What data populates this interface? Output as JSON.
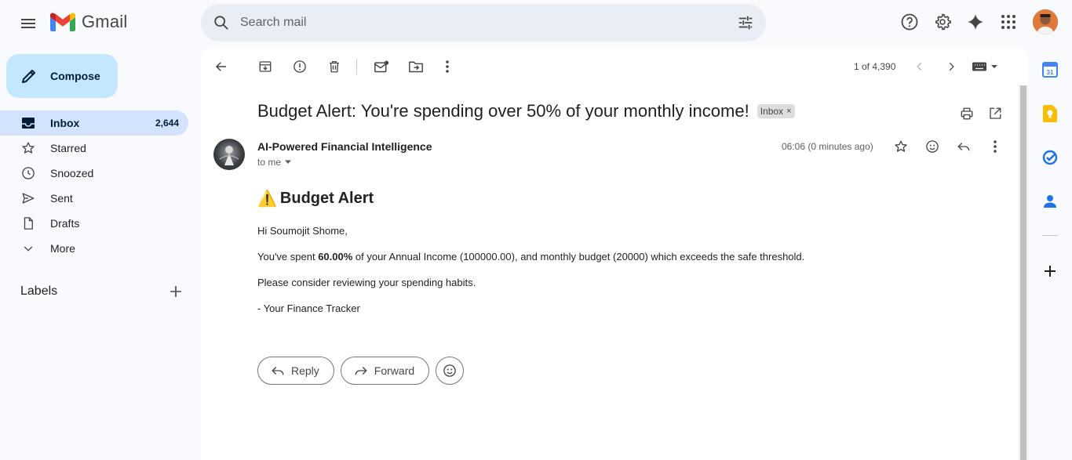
{
  "app": {
    "name": "Gmail",
    "colors": {
      "blue": "#4285f4",
      "red": "#ea4335",
      "yellow": "#fbbc04",
      "green": "#34a853",
      "compose_bg": "#c2e7ff",
      "active_nav": "#d3e3fd"
    }
  },
  "search": {
    "placeholder": "Search mail"
  },
  "header": {
    "icons": [
      "menu-icon",
      "search-icon",
      "filter-icon",
      "help-icon",
      "settings-icon",
      "gemini-icon",
      "apps-icon"
    ]
  },
  "compose": {
    "label": "Compose"
  },
  "sidebar": {
    "items": [
      {
        "label": "Inbox",
        "count": "2,644",
        "icon": "inbox-icon"
      },
      {
        "label": "Starred",
        "count": "",
        "icon": "star-icon"
      },
      {
        "label": "Snoozed",
        "count": "",
        "icon": "clock-icon"
      },
      {
        "label": "Sent",
        "count": "",
        "icon": "send-icon"
      },
      {
        "label": "Drafts",
        "count": "",
        "icon": "draft-icon"
      },
      {
        "label": "More",
        "count": "",
        "icon": "chevron-down-icon"
      }
    ],
    "labels_heading": "Labels"
  },
  "toolbar": {
    "pager": "1 of 4,390",
    "icons": [
      "back-arrow-icon",
      "archive-icon",
      "report-spam-icon",
      "delete-icon",
      "mark-unread-icon",
      "move-to-icon",
      "more-vert-icon",
      "prev-icon",
      "next-icon",
      "keyboard-icon"
    ]
  },
  "email": {
    "subject": "Budget Alert: You're spending over 50% of your monthly income!",
    "label_chip": "Inbox",
    "label_chip_close": "×",
    "sender": "AI-Powered Financial Intelligence",
    "to": "to me",
    "time": "06:06 (0 minutes ago)",
    "body": {
      "warning_emoji": "⚠️",
      "heading": "Budget Alert",
      "greeting": "Hi Soumojit Shome,",
      "line1_pre": "You've spent ",
      "line1_bold": "60.00%",
      "line1_post": " of your Annual Income (100000.00), and monthly budget (20000) which exceeds the safe threshold.",
      "line2": "Please consider reviewing your spending habits.",
      "signature": "- Your Finance Tracker"
    },
    "reply_label": "Reply",
    "forward_label": "Forward"
  },
  "right_panel": {
    "icons": [
      "calendar-icon",
      "keep-icon",
      "tasks-icon",
      "contacts-icon",
      "add-addon-icon"
    ],
    "calendar_day": "31"
  }
}
